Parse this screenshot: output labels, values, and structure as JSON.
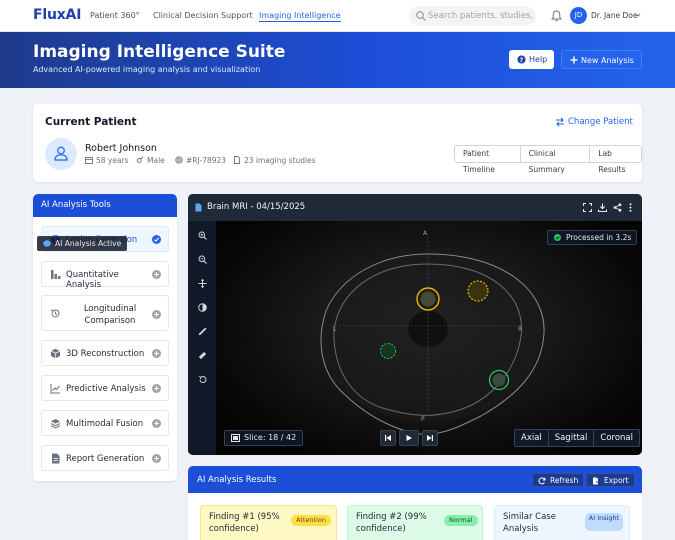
{
  "nav": {
    "brand": "FluxAI",
    "links": [
      "Patient 360°",
      "Clinical Decision Support",
      "Imaging Intelligence"
    ],
    "active_link": "Imaging Intelligence",
    "search_placeholder": "Search patients, studies,...",
    "user_initials": "JD",
    "user_name": "Dr. Jane Doe"
  },
  "hero": {
    "title": "Imaging Intelligence Suite",
    "subtitle": "Advanced AI-powered imaging analysis and visualization",
    "help_label": "Help",
    "new_analysis_label": "New Analysis"
  },
  "patient": {
    "section_title": "Current Patient",
    "change_label": "Change Patient",
    "name": "Robert Johnson",
    "age": "58 years",
    "sex": "Male",
    "id": "#RJ-78923",
    "studies": "23 imaging studies",
    "tabs": [
      "Patient Timeline",
      "Clinical Summary",
      "Lab Results"
    ]
  },
  "tools": {
    "header": "AI Analysis Tools",
    "items": [
      {
        "label": "Lesion Detection",
        "icon": "brain-icon",
        "active": true
      },
      {
        "label": "Quantitative Analysis",
        "icon": "chart-bar-icon",
        "active": false
      },
      {
        "label": "Longitudinal Comparison",
        "icon": "history-icon",
        "active": false
      },
      {
        "label": "3D Reconstruction",
        "icon": "cube-icon",
        "active": false
      },
      {
        "label": "Predictive Analysis",
        "icon": "chart-line-icon",
        "active": false
      },
      {
        "label": "Multimodal Fusion",
        "icon": "layers-icon",
        "active": false
      },
      {
        "label": "Report Generation",
        "icon": "file-icon",
        "active": false
      }
    ]
  },
  "viewer": {
    "title": "Brain MRI - 04/15/2025",
    "ai_badge": "AI Analysis Active",
    "processed_badge": "Processed in 3.2s",
    "orientation": {
      "top": "A",
      "bottom": "P",
      "left": "L",
      "right": "R"
    },
    "slice_label": "Slice: 18 / 42",
    "slice_current": 18,
    "slice_total": 42,
    "views": [
      "Axial",
      "Sagittal",
      "Coronal"
    ],
    "colors": {
      "finding_attention": "#eab308",
      "finding_normal": "#22c55e",
      "processed": "#22c55e"
    }
  },
  "results": {
    "header": "AI Analysis Results",
    "refresh_label": "Refresh",
    "export_label": "Export",
    "cards": [
      {
        "title": "Finding #1 (95% confidence)",
        "tag": "Attention",
        "bg": "#fef9c3",
        "border": "#fde68a",
        "tag_bg": "#fde047",
        "tag_color": "#713f12"
      },
      {
        "title": "Finding #2 (99% confidence)",
        "tag": "Normal",
        "bg": "#dcfce7",
        "border": "#bbf7d0",
        "tag_bg": "#86efac",
        "tag_color": "#14532d"
      },
      {
        "title": "Similar Case Analysis",
        "tag": "AI Insight",
        "bg": "#eff6ff",
        "border": "#dbeafe",
        "tag_bg": "#bfdbfe",
        "tag_color": "#1e3a8a"
      }
    ]
  }
}
